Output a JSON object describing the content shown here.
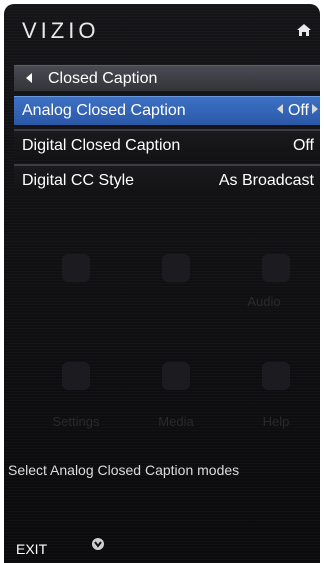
{
  "header": {
    "brand": "VIZIO",
    "home_icon": "home-icon"
  },
  "breadcrumb": {
    "title": "Closed Caption",
    "back_icon": "back-arrow-icon"
  },
  "menu": {
    "items": [
      {
        "label": "Analog Closed Caption",
        "value": "Off",
        "selected": true
      },
      {
        "label": "Digital Closed Caption",
        "value": "Off",
        "selected": false
      },
      {
        "label": "Digital CC Style",
        "value": "As Broadcast",
        "selected": false
      }
    ]
  },
  "background_grid": {
    "items": [
      "Audio",
      "Settings",
      "Media",
      "Help"
    ]
  },
  "help_text": "Select Analog Closed Caption modes",
  "footer": {
    "exit_label": "EXIT",
    "down_icon": "down-chevron-icon"
  },
  "colors": {
    "selected": "#2f62b3",
    "background": "#0f0f11"
  }
}
